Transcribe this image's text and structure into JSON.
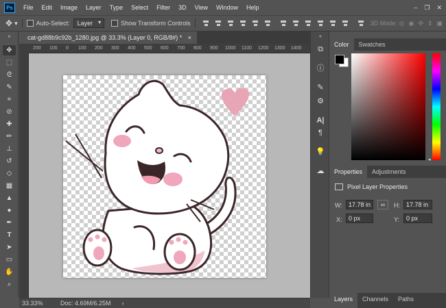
{
  "app": {
    "logo": "Ps"
  },
  "menu": [
    "File",
    "Edit",
    "Image",
    "Layer",
    "Type",
    "Select",
    "Filter",
    "3D",
    "View",
    "Window",
    "Help"
  ],
  "options_bar": {
    "auto_select_label": "Auto-Select:",
    "auto_select_value": "Layer",
    "show_transform_label": "Show Transform Controls",
    "mode_3d": "3D Mode:"
  },
  "document": {
    "tab_title": "cat-gd88b9c92b_1280.jpg @ 33.3% (Layer 0, RGB/8#) *",
    "close": "×"
  },
  "ruler_ticks": [
    "200",
    "100",
    "0",
    "100",
    "200",
    "300",
    "400",
    "500",
    "600",
    "700",
    "800",
    "900",
    "1000",
    "1100",
    "1200",
    "1300",
    "1400"
  ],
  "color_panel": {
    "tabs": [
      "Color",
      "Swatches"
    ],
    "fg": "#000000",
    "bg": "#ffffff"
  },
  "properties_panel": {
    "tabs": [
      "Properties",
      "Adjustments"
    ],
    "title": "Pixel Layer Properties",
    "w_label": "W:",
    "w_value": "17.78 in",
    "h_label": "H:",
    "h_value": "17.78 in",
    "x_label": "X:",
    "x_value": "0 px",
    "y_label": "Y:",
    "y_value": "0 px"
  },
  "status": {
    "zoom": "33.33%",
    "doc": "Doc: 4.69M/6.25M"
  },
  "bottom_tabs": [
    "Layers",
    "Channels",
    "Paths"
  ],
  "colors": {
    "heart": "#e8a5b6",
    "cheek": "#f0a7bb",
    "accent_blue": "#31a8ff"
  }
}
